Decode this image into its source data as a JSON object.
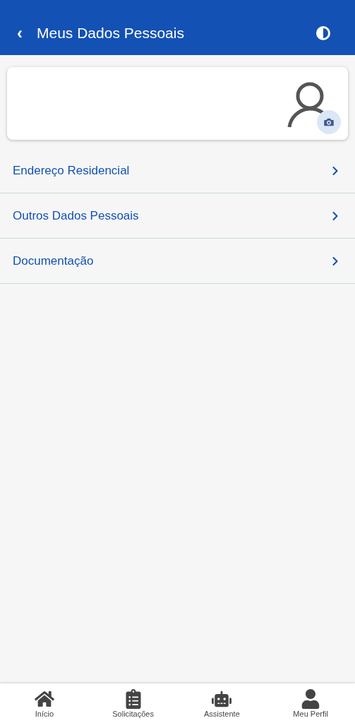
{
  "header": {
    "back_icon": "‹",
    "title": "Meus Dados Pessoais"
  },
  "menu_items": [
    {
      "label": "Endereço Residencial"
    },
    {
      "label": "Outros Dados Pessoais"
    },
    {
      "label": "Documentação"
    }
  ],
  "bottom_nav": [
    {
      "kind": "home",
      "label": "Início"
    },
    {
      "kind": "clipboard",
      "label": "Solicitações"
    },
    {
      "kind": "robot",
      "label": "Assistente"
    },
    {
      "kind": "user",
      "label": "Meu Perfil"
    }
  ]
}
